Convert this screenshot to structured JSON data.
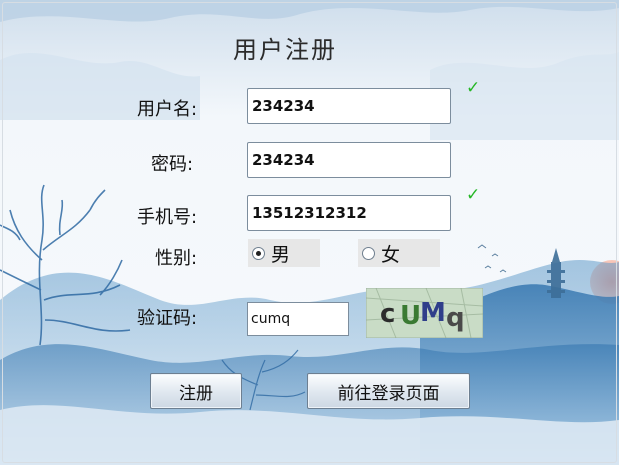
{
  "form": {
    "title": "用户注册",
    "username_label": "用户名:",
    "username_value": "234234",
    "password_label": "密码:",
    "password_value": "234234",
    "phone_label": "手机号:",
    "phone_value": "13512312312",
    "gender_label": "性别:",
    "gender_male": "男",
    "gender_female": "女",
    "gender_selected": "男",
    "captcha_label": "验证码:",
    "captcha_input": "cumq",
    "captcha_image_text": "cUMq",
    "username_valid_mark": "✓",
    "phone_valid_mark": "✓"
  },
  "buttons": {
    "register": "注册",
    "go_login": "前往登录页面"
  },
  "colors": {
    "check": "#26b726",
    "sky": "#eef4fa",
    "mountain": "#3f7fb6"
  }
}
